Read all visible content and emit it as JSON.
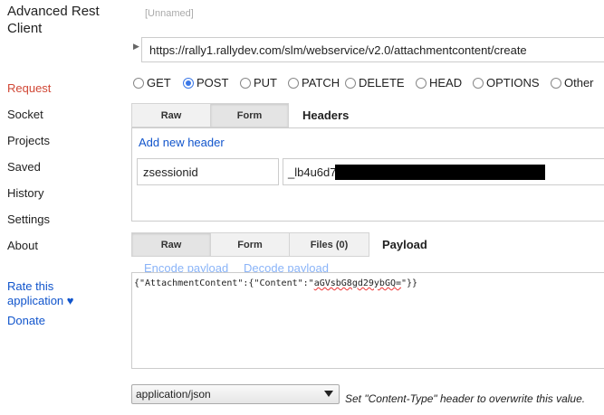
{
  "app": {
    "title_line1": "Advanced Rest",
    "title_line2": "Client"
  },
  "sidebar": {
    "items": [
      {
        "label": "Request",
        "active": true
      },
      {
        "label": "Socket"
      },
      {
        "label": "Projects"
      },
      {
        "label": "Saved"
      },
      {
        "label": "History"
      },
      {
        "label": "Settings"
      },
      {
        "label": "About"
      }
    ],
    "rate_line1": "Rate this",
    "rate_line2": "application ♥",
    "donate": "Donate"
  },
  "request": {
    "name": "[Unnamed]",
    "url": "https://rally1.rallydev.com/slm/webservice/v2.0/attachmentcontent/create",
    "methods": [
      "GET",
      "POST",
      "PUT",
      "PATCH",
      "DELETE",
      "HEAD",
      "OPTIONS",
      "Other"
    ],
    "selected_method": "POST"
  },
  "headers": {
    "tabs": [
      "Raw",
      "Form"
    ],
    "active_tab": "Form",
    "title": "Headers",
    "add_label": "Add new header",
    "name": "zsessionid",
    "value_visible": "_lb4u6d7"
  },
  "payload": {
    "tabs": [
      "Raw",
      "Form",
      "Files (0)"
    ],
    "active_tab": "Raw",
    "title": "Payload",
    "encode_label": "Encode payload",
    "decode_label": "Decode payload",
    "body_prefix": "{\"AttachmentContent\":{\"Content\":\"",
    "body_value": "aGVsbG8gd29ybGQ=",
    "body_suffix": "\"}}"
  },
  "content_type": {
    "selected": "application/json",
    "hint": "Set \"Content-Type\" header to overwrite this value."
  },
  "colors": {
    "active_nav": "#d14836",
    "link": "#1155cc",
    "radio_checked": "#3b78e7"
  }
}
